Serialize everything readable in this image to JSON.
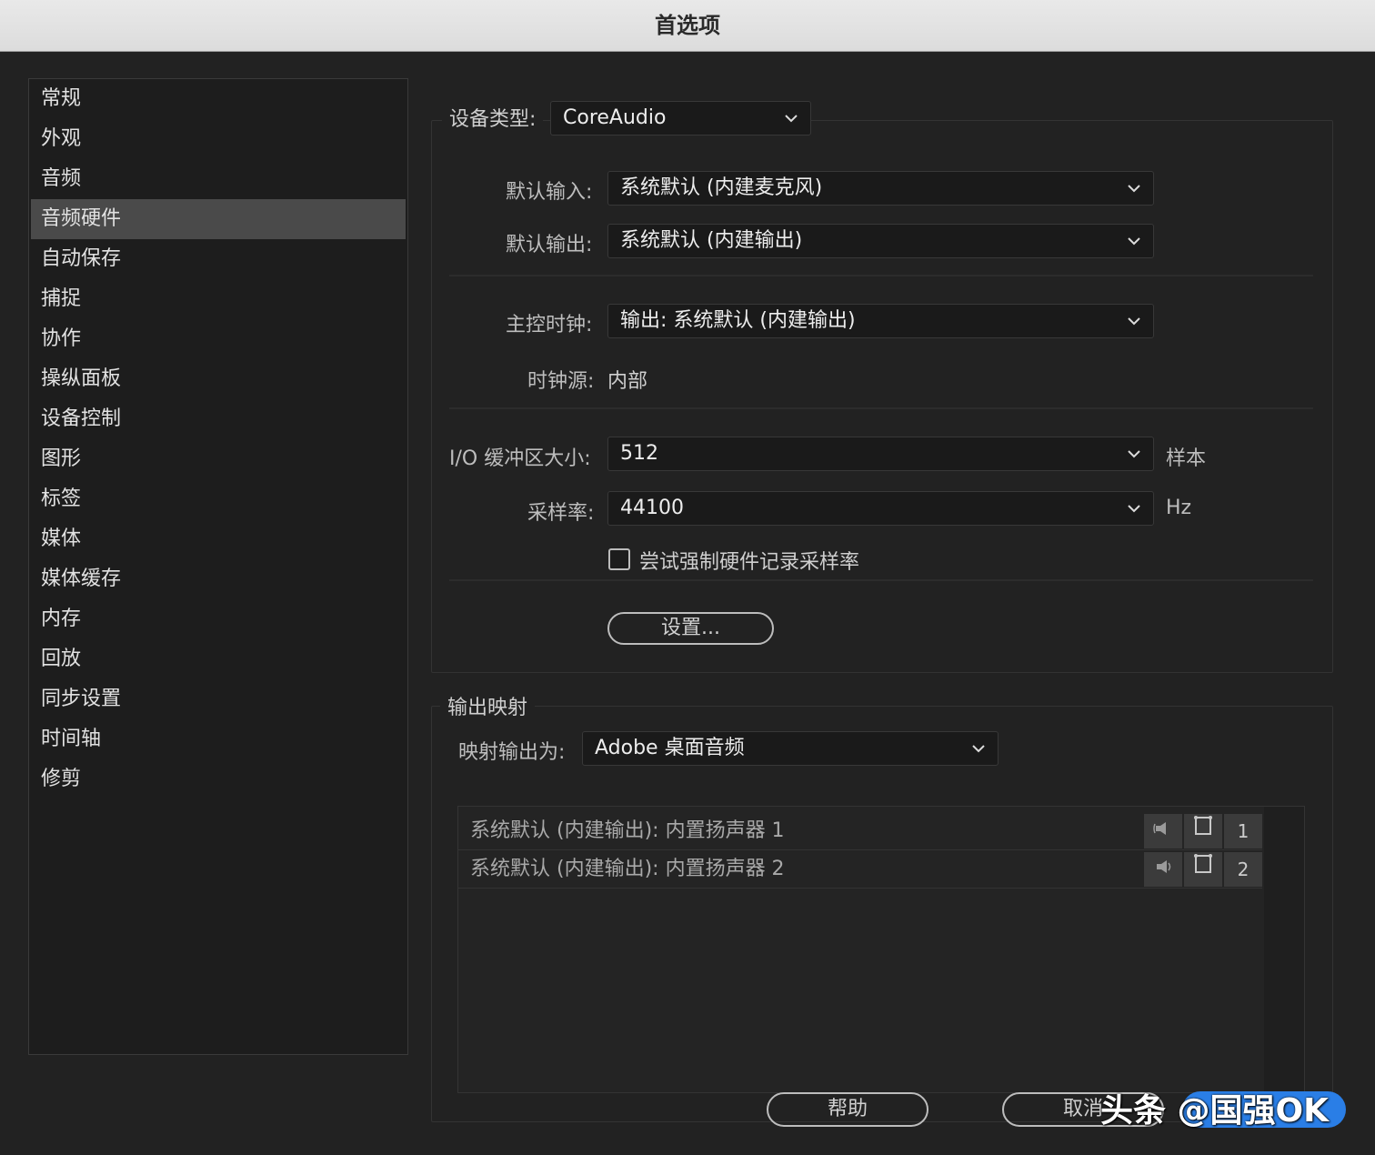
{
  "window": {
    "title": "首选项"
  },
  "sidebar": {
    "items": [
      {
        "label": "常规"
      },
      {
        "label": "外观"
      },
      {
        "label": "音频"
      },
      {
        "label": "音频硬件"
      },
      {
        "label": "自动保存"
      },
      {
        "label": "捕捉"
      },
      {
        "label": "协作"
      },
      {
        "label": "操纵面板"
      },
      {
        "label": "设备控制"
      },
      {
        "label": "图形"
      },
      {
        "label": "标签"
      },
      {
        "label": "媒体"
      },
      {
        "label": "媒体缓存"
      },
      {
        "label": "内存"
      },
      {
        "label": "回放"
      },
      {
        "label": "同步设置"
      },
      {
        "label": "时间轴"
      },
      {
        "label": "修剪"
      }
    ],
    "selected": "音频硬件"
  },
  "device": {
    "type_label": "设备类型:",
    "type_value": "CoreAudio",
    "default_input_label": "默认输入:",
    "default_input_value": "系统默认 (内建麦克风)",
    "default_output_label": "默认输出:",
    "default_output_value": "系统默认 (内建输出)",
    "master_clock_label": "主控时钟:",
    "master_clock_value": "输出: 系统默认 (内建输出)",
    "clock_source_label": "时钟源:",
    "clock_source_value": "内部",
    "buffer_label": "I/O 缓冲区大小:",
    "buffer_value": "512",
    "buffer_unit": "样本",
    "sample_rate_label": "采样率:",
    "sample_rate_value": "44100",
    "sample_rate_unit": "Hz",
    "force_rate_label": "尝试强制硬件记录采样率",
    "force_rate_checked": false,
    "settings_button": "设置..."
  },
  "output_mapping": {
    "legend": "输出映射",
    "map_label": "映射输出为:",
    "map_value": "Adobe 桌面音频",
    "rows": [
      {
        "name": "系统默认 (内建输出): 内置扬声器 1",
        "channel": "1"
      },
      {
        "name": "系统默认 (内建输出): 内置扬声器 2",
        "channel": "2"
      }
    ]
  },
  "footer": {
    "help_button": "帮助",
    "cancel_button": "取消"
  },
  "watermark": "头条 @国强OK",
  "colors": {
    "accent": "#2a7ee6",
    "selected_row": "#4a4a4a",
    "background": "#222222"
  }
}
